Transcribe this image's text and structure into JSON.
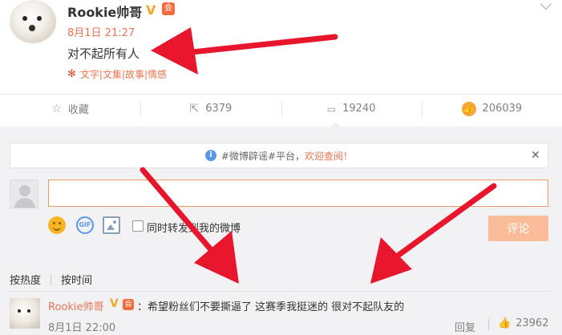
{
  "post": {
    "username": "Rookie帅哥",
    "verified_mark": "V",
    "vip_badge": "会",
    "time": "8月1日 21:27",
    "text": "对不起所有人",
    "tags": "文字|文集|故事|情感"
  },
  "actions": {
    "favorite": "收藏",
    "reposts": "6379",
    "comments": "19240",
    "likes": "206039"
  },
  "comment_box": {
    "notice_prefix": "#微博辟谣#平台，",
    "notice_link": "欢迎查阅！",
    "repost_label": "同时转发到我的微博",
    "submit_label": "评论",
    "gif_label": "GIF"
  },
  "sort": {
    "by_hot": "按热度",
    "by_time": "按时间"
  },
  "top_comment": {
    "username": "Rookie帅哥",
    "verified_mark": "V",
    "vip_badge": "会",
    "text": "：希望粉丝们不要撕逼了 这赛季我挺迷的 很对不起队友的",
    "time": "8月1日 22:00",
    "reply_label": "回复",
    "likes": "23962"
  },
  "colors": {
    "accent": "#eb7350",
    "arrow": "#e8162c",
    "submit_bg": "#fbbc99",
    "comment_area_bg": "#f2f2f5"
  },
  "icons": [
    "avatar",
    "verified-icon",
    "vip-icon",
    "chevron-down-icon",
    "flower-icon",
    "star-icon",
    "repost-icon",
    "comment-icon",
    "like-icon",
    "info-icon",
    "close-icon",
    "smile-icon",
    "gif-icon",
    "image-icon",
    "checkbox"
  ]
}
